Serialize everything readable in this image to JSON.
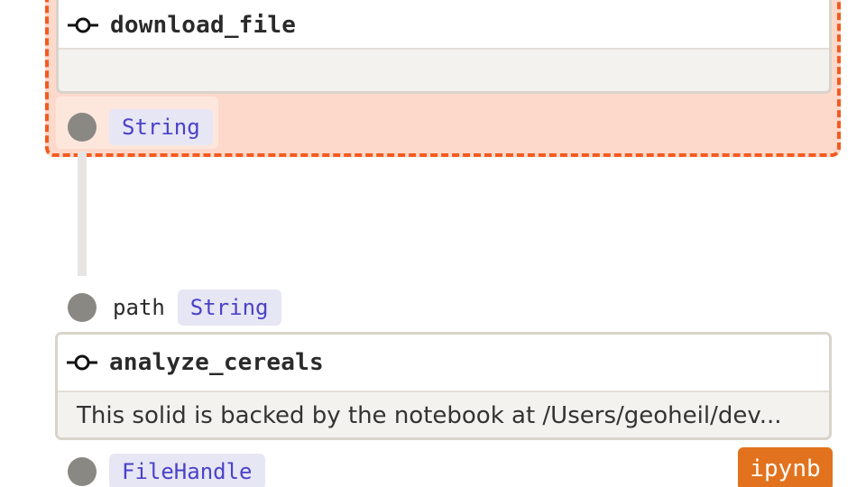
{
  "colors": {
    "selection_fill": "#fdd9cb",
    "selection_border": "#f45a1f",
    "type_text": "#4a42c9",
    "type_bg": "#e7e6f4",
    "port_dot": "#8a8883",
    "kind_tag_bg": "#e2721d"
  },
  "nodes": [
    {
      "title": "download_file",
      "description": "",
      "icon": "op-icon",
      "outputs": [
        {
          "name": "",
          "type": "String"
        }
      ]
    },
    {
      "title": "analyze_cereals",
      "description": "This solid is backed by the notebook at /Users/geoheil/dev...",
      "icon": "op-icon",
      "inputs": [
        {
          "name": "path",
          "type": "String"
        }
      ],
      "outputs": [
        {
          "name": "",
          "type": "FileHandle"
        }
      ],
      "kind_tag": "ipynb"
    }
  ]
}
